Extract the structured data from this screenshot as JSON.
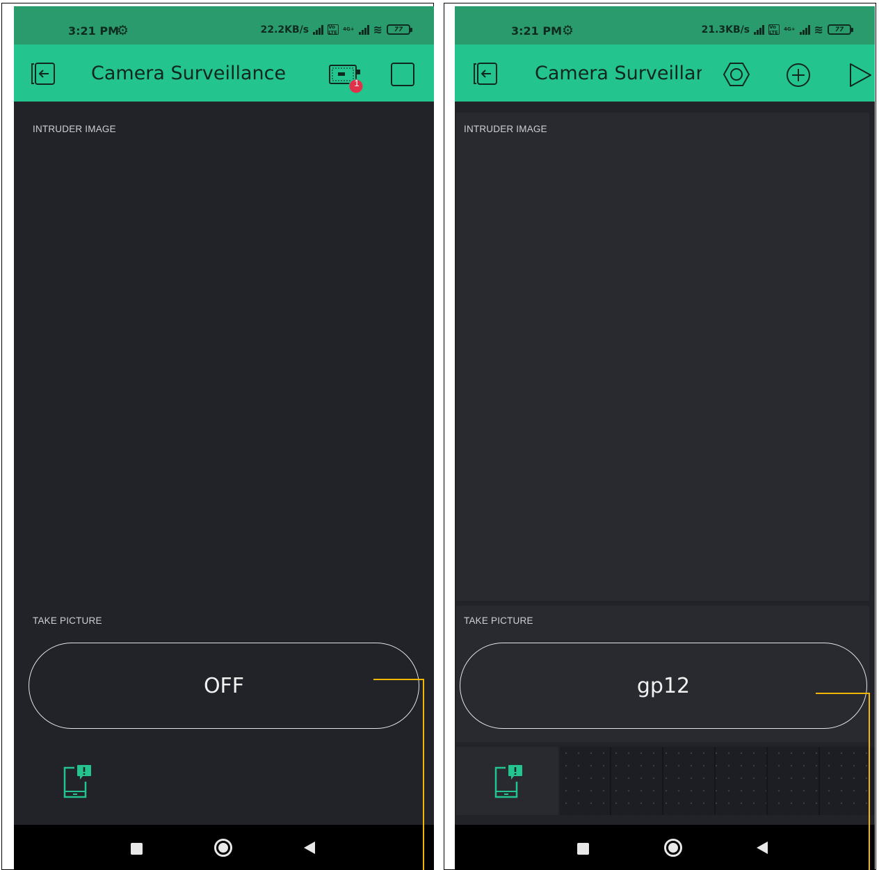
{
  "left": {
    "status": {
      "time": "3:21 PM",
      "speed": "22.2KB/s",
      "network": "4G+",
      "volte": "Vo LTE",
      "battery": "77"
    },
    "appbar": {
      "title": "Camera Surveillance",
      "badge": "1"
    },
    "image_widget": {
      "label": "INTRUDER IMAGE"
    },
    "button_widget": {
      "label": "TAKE PICTURE",
      "state": "OFF"
    }
  },
  "right": {
    "status": {
      "time": "3:21 PM",
      "speed": "21.3KB/s",
      "network": "4G+",
      "volte": "Vo LTE",
      "battery": "77"
    },
    "appbar": {
      "title": "Camera Surveillance"
    },
    "image_widget": {
      "label": "INTRUDER IMAGE"
    },
    "button_widget": {
      "label": "TAKE PICTURE",
      "state": "gp12"
    }
  },
  "colors": {
    "statusbar": "#2a9b6c",
    "appbar": "#23c48e",
    "background": "#222329",
    "panel": "#282a30",
    "accent": "#23c48e",
    "badge": "#e0314b",
    "connector": "#f2b705"
  },
  "icons": {
    "back": "exit-project-icon",
    "device": "device-board-icon",
    "stop": "stop-square-icon",
    "settings": "hexagon-settings-icon",
    "add": "add-circle-icon",
    "play": "play-icon",
    "notification": "phone-notification-icon"
  }
}
